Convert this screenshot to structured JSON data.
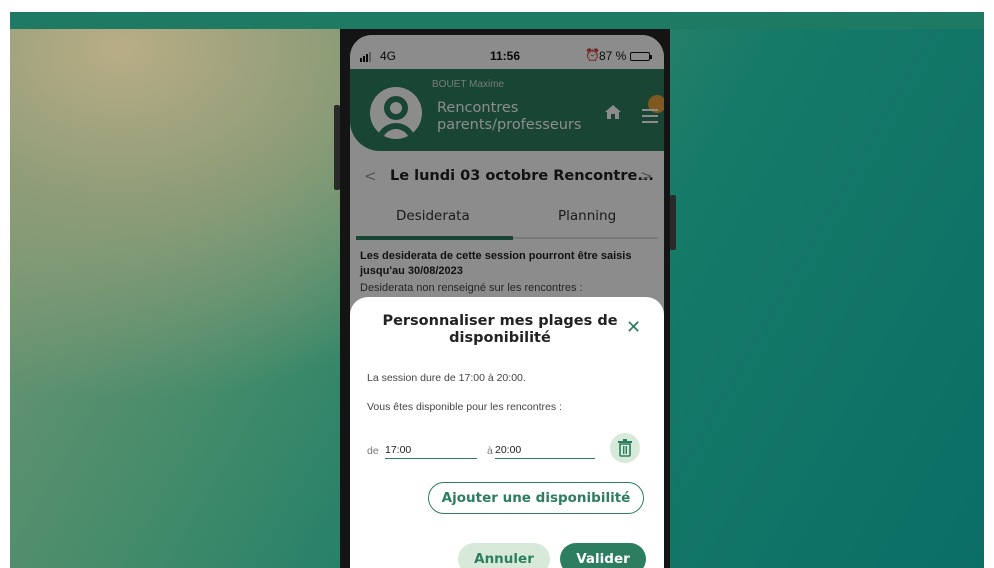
{
  "status_bar": {
    "network": "4G",
    "time": "11:56",
    "battery": "87 %"
  },
  "header": {
    "user_name": "BOUET Maxime",
    "title": "Rencontres parents/professeurs",
    "home_icon": "home-icon",
    "menu_icon": "menu-icon"
  },
  "date_nav": {
    "label": "Le lundi 03 octobre Rencontre...",
    "prev": "<",
    "next": ">"
  },
  "tabs": [
    {
      "label": "Desiderata",
      "active": true
    },
    {
      "label": "Planning",
      "active": false
    }
  ],
  "content": {
    "deadline_text": "Les desiderata de cette session pourront être saisis jusqu'au 30/08/2023",
    "status_text": "Desiderata non renseigné sur les rencontres :"
  },
  "modal": {
    "title": "Personnaliser mes plages de disponibilité",
    "close": "✕",
    "session_text": "La session dure de 17:00 à 20:00.",
    "available_text": "Vous êtes disponible pour les rencontres :",
    "range": {
      "from_prefix": "de",
      "from_value": "17:00",
      "to_prefix": "à",
      "to_value": "20:00"
    },
    "add_button": "Ajouter une disponibilité",
    "cancel_button": "Annuler",
    "validate_button": "Valider"
  },
  "colors": {
    "primary": "#2d7e60",
    "light_green": "#d7ead9",
    "top_bar": "#1e7a63"
  }
}
